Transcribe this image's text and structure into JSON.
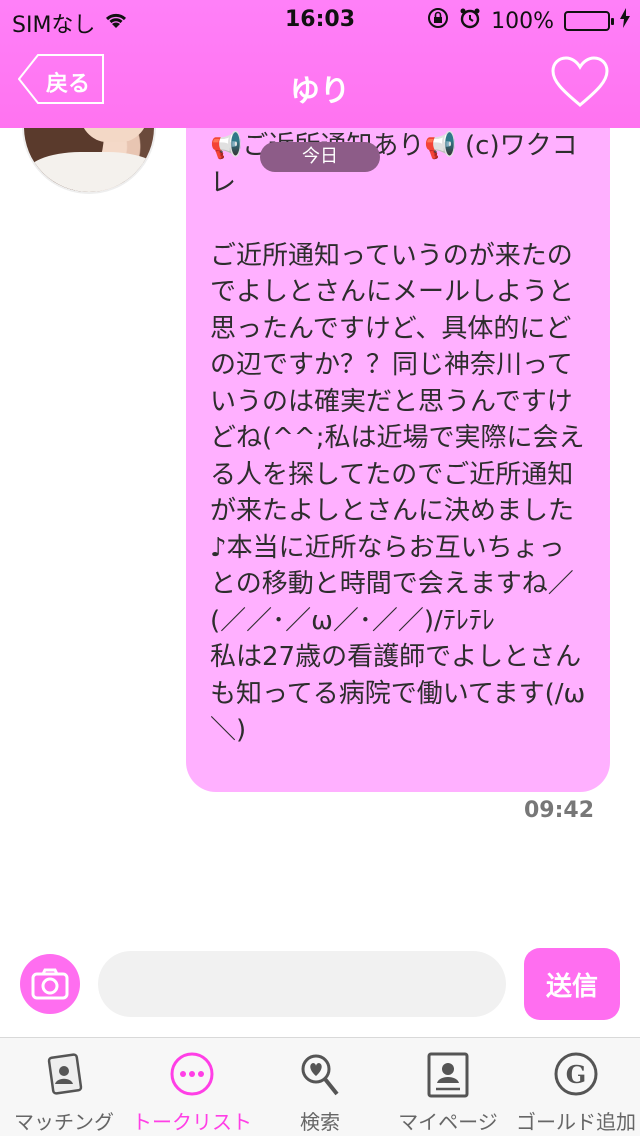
{
  "status_bar": {
    "carrier": "SIMなし",
    "time": "16:03",
    "battery": "100%",
    "battery_level": 1.0
  },
  "nav": {
    "back_label": "戻る",
    "title": "ゆり",
    "favorite_icon": "heart-icon"
  },
  "chat": {
    "date_label": "今日",
    "message": {
      "text": "📢ご近所通知あり📢 (c)ワクコレ\n\nご近所通知っていうのが来たのでよしとさんにメールしようと思ったんですけど、具体的にどの辺ですか？？同じ神奈川っていうのは確実だと思うんですけどね(^^;私は近場で実際に会える人を探してたのでご近所通知が来たよしとさんに決めました♪本当に近所ならお互いちょっとの移動と時間で会えますね／(／／･／ω／･／／)/ﾃﾚﾃﾚ\n私は27歳の看護師でよしとさんも知ってる病院で働いてます(/ω＼)",
      "time": "09:42"
    }
  },
  "composer": {
    "camera_icon": "camera-icon",
    "input_value": "",
    "input_placeholder": "",
    "send_label": "送信"
  },
  "tabs": [
    {
      "label": "マッチング",
      "icon": "matching-card-icon",
      "active": false
    },
    {
      "label": "トークリスト",
      "icon": "chat-bubble-icon",
      "active": true
    },
    {
      "label": "検索",
      "icon": "search-heart-icon",
      "active": false
    },
    {
      "label": "マイページ",
      "icon": "profile-icon",
      "active": false
    },
    {
      "label": "ゴールド追加",
      "icon": "gold-coin-icon",
      "active": false
    }
  ],
  "colors": {
    "accent": "#ff73f0",
    "bubble": "#ffb0ff",
    "active_tab": "#ff3fe6"
  }
}
